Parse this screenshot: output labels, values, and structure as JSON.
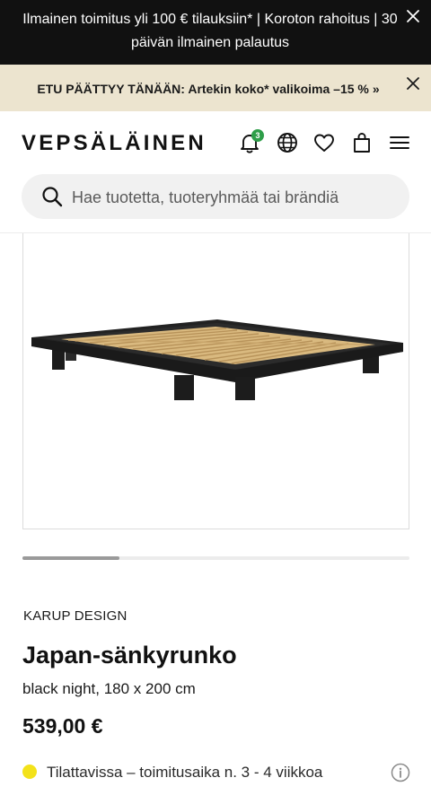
{
  "top_banner": {
    "text": "Ilmainen toimitus yli 100 € tilauksiin* | Koroton rahoitus | 30 päivän ilmainen palautus",
    "close_icon": "close-icon"
  },
  "promo_bar": {
    "text": "ETU PÄÄTTYY TÄNÄÄN: Artekin koko* valikoima –15 %",
    "arrow": "»",
    "close_icon": "close-icon"
  },
  "header": {
    "logo": "VEPSÄLÄINEN",
    "notification_count": "3",
    "icons": [
      "bell-icon",
      "globe-icon",
      "heart-icon",
      "shopping-bag-icon",
      "menu-icon"
    ]
  },
  "search": {
    "placeholder": "Hae tuotetta, tuoteryhmää tai brändiä"
  },
  "gallery": {
    "image_alt": "product-image",
    "scroll_progress": 0.25
  },
  "product": {
    "brand": "KARUP DESIGN",
    "title": "Japan-sänkyrunko",
    "variant": "black night, 180 x 200 cm",
    "price": "539,00 €",
    "stock_text": "Tilattavissa – toimitusaika n. 3 - 4 viikkoa",
    "stock_color": "#f3e21a"
  },
  "colors": {
    "top_banner_bg": "#111111",
    "promo_bg": "#ece4cf",
    "badge": "#2e9e49"
  }
}
